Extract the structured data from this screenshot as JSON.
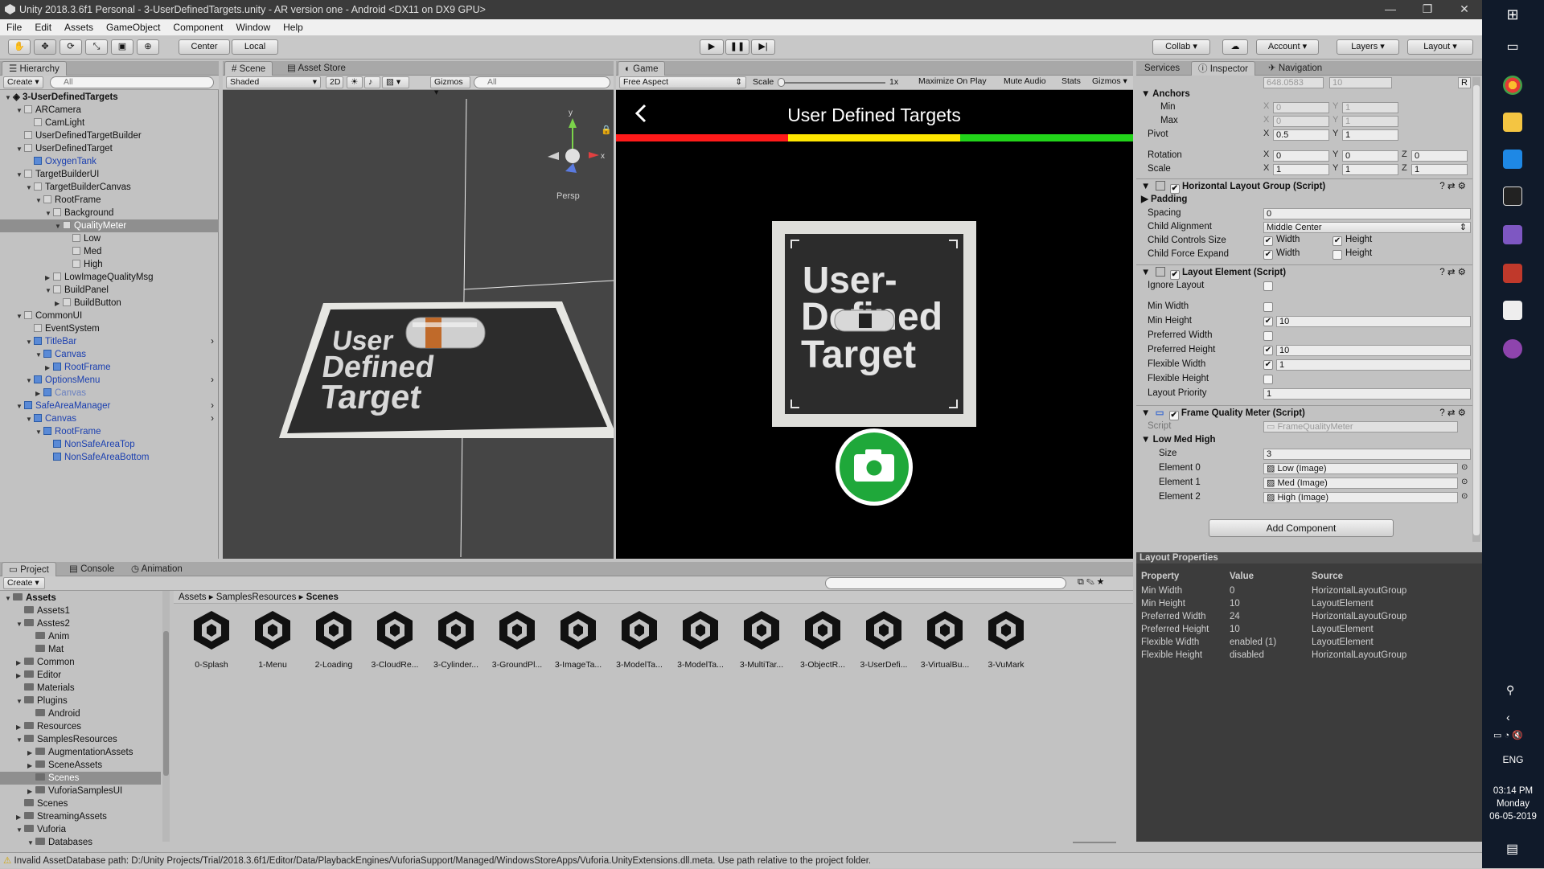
{
  "window": {
    "title": "Unity 2018.3.6f1 Personal - 3-UserDefinedTargets.unity - AR version one - Android <DX11 on DX9 GPU>",
    "minimize": "—",
    "maximize": "❐",
    "close": "✕"
  },
  "menu": [
    "File",
    "Edit",
    "Assets",
    "GameObject",
    "Component",
    "Window",
    "Help"
  ],
  "toolbar": {
    "center": "Center",
    "local": "Local",
    "collab": "Collab",
    "account": "Account",
    "layers": "Layers",
    "layout": "Layout"
  },
  "hierarchy": {
    "tab": "Hierarchy",
    "create": "Create",
    "search_placeholder": "All",
    "scene": "3-UserDefinedTargets",
    "items": [
      {
        "label": "ARCamera",
        "depth": 1,
        "arrow": "open",
        "prefab": false
      },
      {
        "label": "CamLight",
        "depth": 2,
        "arrow": "",
        "prefab": false
      },
      {
        "label": "UserDefinedTargetBuilder",
        "depth": 1,
        "arrow": "",
        "prefab": false
      },
      {
        "label": "UserDefinedTarget",
        "depth": 1,
        "arrow": "open",
        "prefab": false
      },
      {
        "label": "OxygenTank",
        "depth": 2,
        "arrow": "",
        "prefab": true
      },
      {
        "label": "TargetBuilderUI",
        "depth": 1,
        "arrow": "open",
        "prefab": false
      },
      {
        "label": "TargetBuilderCanvas",
        "depth": 2,
        "arrow": "open",
        "prefab": false
      },
      {
        "label": "RootFrame",
        "depth": 3,
        "arrow": "open",
        "prefab": false
      },
      {
        "label": "Background",
        "depth": 4,
        "arrow": "open",
        "prefab": false
      },
      {
        "label": "QualityMeter",
        "depth": 5,
        "arrow": "open",
        "prefab": false,
        "selected": true
      },
      {
        "label": "Low",
        "depth": 6,
        "arrow": "",
        "prefab": false
      },
      {
        "label": "Med",
        "depth": 6,
        "arrow": "",
        "prefab": false
      },
      {
        "label": "High",
        "depth": 6,
        "arrow": "",
        "prefab": false
      },
      {
        "label": "LowImageQualityMsg",
        "depth": 4,
        "arrow": "closed",
        "prefab": false
      },
      {
        "label": "BuildPanel",
        "depth": 4,
        "arrow": "open",
        "prefab": false
      },
      {
        "label": "BuildButton",
        "depth": 5,
        "arrow": "closed",
        "prefab": false
      },
      {
        "label": "CommonUI",
        "depth": 1,
        "arrow": "open",
        "prefab": false
      },
      {
        "label": "EventSystem",
        "depth": 2,
        "arrow": "",
        "prefab": false
      },
      {
        "label": "TitleBar",
        "depth": 2,
        "arrow": "open",
        "prefab": true
      },
      {
        "label": "Canvas",
        "depth": 3,
        "arrow": "open",
        "prefab": true
      },
      {
        "label": "RootFrame",
        "depth": 4,
        "arrow": "closed",
        "prefab": true
      },
      {
        "label": "OptionsMenu",
        "depth": 2,
        "arrow": "open",
        "prefab": true
      },
      {
        "label": "Canvas",
        "depth": 3,
        "arrow": "closed",
        "prefab": true,
        "dim": true
      },
      {
        "label": "SafeAreaManager",
        "depth": 1,
        "arrow": "open",
        "prefab": true
      },
      {
        "label": "Canvas",
        "depth": 2,
        "arrow": "open",
        "prefab": true
      },
      {
        "label": "RootFrame",
        "depth": 3,
        "arrow": "open",
        "prefab": true
      },
      {
        "label": "NonSafeAreaTop",
        "depth": 4,
        "arrow": "",
        "prefab": true
      },
      {
        "label": "NonSafeAreaBottom",
        "depth": 4,
        "arrow": "",
        "prefab": true
      }
    ]
  },
  "scene": {
    "tab_scene": "Scene",
    "tab_store": "Asset Store",
    "shading": "Shaded",
    "mode_2d": "2D",
    "gizmos": "Gizmos",
    "search_placeholder": "All",
    "persp": "Persp",
    "target_text_1": "User",
    "target_text_2": "Defined",
    "target_text_3": "Target"
  },
  "game": {
    "tab": "Game",
    "aspect": "Free Aspect",
    "scale_label": "Scale",
    "scale_value": "1x",
    "maximize": "Maximize On Play",
    "mute": "Mute Audio",
    "stats": "Stats",
    "gizmos": "Gizmos",
    "title": "User Defined Targets",
    "target_1": "User-",
    "target_2": "Defined",
    "target_3": "Target",
    "colors": {
      "low": "#ff1a1a",
      "med": "#ffe600",
      "high": "#22d41a",
      "camera": "#1fa83a"
    }
  },
  "inspector": {
    "tab_services": "Services",
    "tab_inspector": "Inspector",
    "tab_navigation": "Navigation",
    "top_x": "648.0583",
    "top_y": "10",
    "top_r": "R",
    "anchors": "Anchors",
    "min": "Min",
    "max": "Max",
    "pivot": "Pivot",
    "rotation": "Rotation",
    "scale": "Scale",
    "ax": "X",
    "ay": "Y",
    "az": "Z",
    "anchor_min_x": "0",
    "anchor_min_y": "1",
    "anchor_max_x": "0",
    "anchor_max_y": "1",
    "pivot_x": "0.5",
    "pivot_y": "1",
    "rot_x": "0",
    "rot_y": "0",
    "rot_z": "0",
    "scale_x": "1",
    "scale_y": "1",
    "scale_z": "1",
    "hlg_title": "Horizontal Layout Group (Script)",
    "padding": "Padding",
    "spacing": "Spacing",
    "spacing_value": "0",
    "child_alignment": "Child Alignment",
    "child_alignment_value": "Middle Center",
    "child_controls": "Child Controls Size",
    "child_force": "Child Force Expand",
    "width": "Width",
    "height": "Height",
    "le_title": "Layout Element (Script)",
    "ignore_layout": "Ignore Layout",
    "min_width": "Min Width",
    "min_height": "Min Height",
    "min_height_value": "10",
    "pref_width": "Preferred Width",
    "pref_height": "Preferred Height",
    "pref_height_value": "10",
    "flex_width": "Flexible Width",
    "flex_width_value": "1",
    "flex_height": "Flexible Height",
    "layout_priority": "Layout Priority",
    "layout_priority_value": "1",
    "fqm_title": "Frame Quality Meter (Script)",
    "script": "Script",
    "script_value": "FrameQualityMeter",
    "low_med_high": "Low Med High",
    "size": "Size",
    "size_value": "3",
    "element0": "Element 0",
    "element0_value": "Low (Image)",
    "element1": "Element 1",
    "element1_value": "Med (Image)",
    "element2": "Element 2",
    "element2_value": "High (Image)",
    "add_component": "Add Component"
  },
  "layout_properties": {
    "title": "Layout Properties",
    "headers": [
      "Property",
      "Value",
      "Source"
    ],
    "rows": [
      [
        "Min Width",
        "0",
        "HorizontalLayoutGroup"
      ],
      [
        "Min Height",
        "10",
        "LayoutElement"
      ],
      [
        "Preferred Width",
        "24",
        "HorizontalLayoutGroup"
      ],
      [
        "Preferred Height",
        "10",
        "LayoutElement"
      ],
      [
        "Flexible Width",
        "enabled (1)",
        "LayoutElement"
      ],
      [
        "Flexible Height",
        "disabled",
        "HorizontalLayoutGroup"
      ]
    ]
  },
  "project": {
    "tab_project": "Project",
    "tab_console": "Console",
    "tab_animation": "Animation",
    "create": "Create",
    "breadcrumb": [
      "Assets",
      "SamplesResources",
      "Scenes"
    ],
    "tree": [
      {
        "label": "Assets",
        "depth": 0,
        "arrow": "open",
        "bold": true
      },
      {
        "label": "Assets1",
        "depth": 1,
        "arrow": ""
      },
      {
        "label": "Asstes2",
        "depth": 1,
        "arrow": "open"
      },
      {
        "label": "Anim",
        "depth": 2,
        "arrow": ""
      },
      {
        "label": "Mat",
        "depth": 2,
        "arrow": ""
      },
      {
        "label": "Common",
        "depth": 1,
        "arrow": "closed"
      },
      {
        "label": "Editor",
        "depth": 1,
        "arrow": "closed"
      },
      {
        "label": "Materials",
        "depth": 1,
        "arrow": ""
      },
      {
        "label": "Plugins",
        "depth": 1,
        "arrow": "open"
      },
      {
        "label": "Android",
        "depth": 2,
        "arrow": ""
      },
      {
        "label": "Resources",
        "depth": 1,
        "arrow": "closed"
      },
      {
        "label": "SamplesResources",
        "depth": 1,
        "arrow": "open"
      },
      {
        "label": "AugmentationAssets",
        "depth": 2,
        "arrow": "closed"
      },
      {
        "label": "SceneAssets",
        "depth": 2,
        "arrow": "closed"
      },
      {
        "label": "Scenes",
        "depth": 2,
        "arrow": "",
        "selected": true
      },
      {
        "label": "VuforiaSamplesUI",
        "depth": 2,
        "arrow": "closed"
      },
      {
        "label": "Scenes",
        "depth": 1,
        "arrow": ""
      },
      {
        "label": "StreamingAssets",
        "depth": 1,
        "arrow": "closed"
      },
      {
        "label": "Vuforia",
        "depth": 1,
        "arrow": "open"
      },
      {
        "label": "Databases",
        "depth": 2,
        "arrow": "open"
      }
    ],
    "scenes": [
      "0-Splash",
      "1-Menu",
      "2-Loading",
      "3-CloudRe...",
      "3-Cylinder...",
      "3-GroundPl...",
      "3-ImageTa...",
      "3-ModelTa...",
      "3-ModelTa...",
      "3-MultiTar...",
      "3-ObjectR...",
      "3-UserDefi...",
      "3-VirtualBu...",
      "3-VuMark"
    ]
  },
  "status": {
    "message": "Invalid AssetDatabase path: D:/Unity Projects/Trial/2018.3.6f1/Editor/Data/PlaybackEngines/VuforiaSupport/Managed/WindowsStoreApps/Vuforia.UnityExtensions.dll.meta. Use path relative to the project folder."
  },
  "taskbar": {
    "lang": "ENG",
    "time": "03:14 PM",
    "day": "Monday",
    "date": "06-05-2019"
  }
}
